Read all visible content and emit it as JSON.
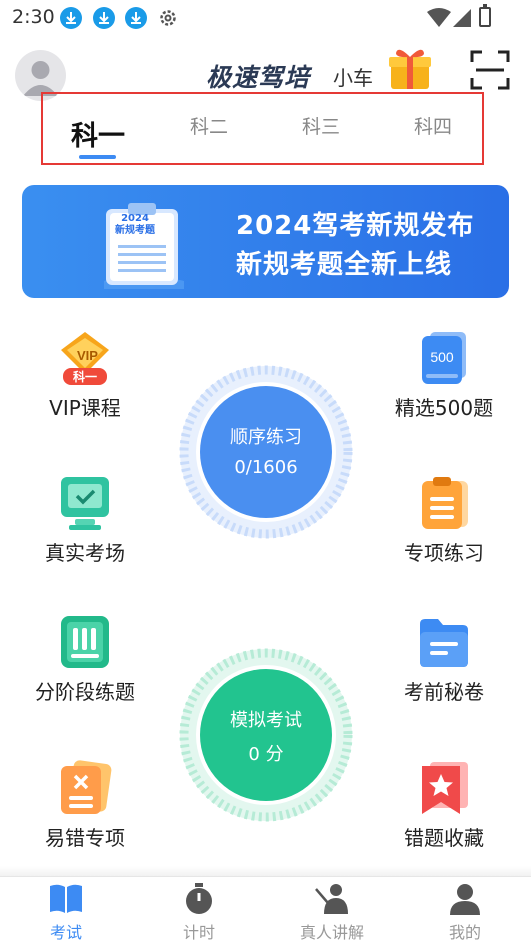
{
  "status_bar": {
    "time": "2:30"
  },
  "header": {
    "brand_name": "极速驾培",
    "brand_sub": "小车"
  },
  "tabs": [
    {
      "label": "科一",
      "active": true
    },
    {
      "label": "科二",
      "active": false
    },
    {
      "label": "科三",
      "active": false
    },
    {
      "label": "科四",
      "active": false
    }
  ],
  "banner": {
    "clipboard_year": "2024",
    "clipboard_text": "新规考题",
    "line1": "2024驾考新规发布",
    "line2": "新规考题全新上线"
  },
  "features": {
    "vip": {
      "label": "VIP课程",
      "badge": "科一",
      "tag": "VIP"
    },
    "select500": {
      "label": "精选500题",
      "badge": "500"
    },
    "real_exam": {
      "label": "真实考场"
    },
    "special": {
      "label": "专项练习"
    },
    "staged": {
      "label": "分阶段练题"
    },
    "secret": {
      "label": "考前秘卷"
    },
    "error_prone": {
      "label": "易错专项"
    },
    "favorites": {
      "label": "错题收藏"
    }
  },
  "practice": {
    "title": "顺序练习",
    "progress": "0/1606",
    "accent": "#4a8ff0"
  },
  "mock": {
    "title": "模拟考试",
    "score": "0 分",
    "accent": "#22c48f"
  },
  "bottom_nav": [
    {
      "label": "考试",
      "icon": "book-icon",
      "active": true
    },
    {
      "label": "计时",
      "icon": "stopwatch-icon",
      "active": false
    },
    {
      "label": "真人讲解",
      "icon": "teacher-icon",
      "active": false
    },
    {
      "label": "我的",
      "icon": "person-icon",
      "active": false
    }
  ]
}
